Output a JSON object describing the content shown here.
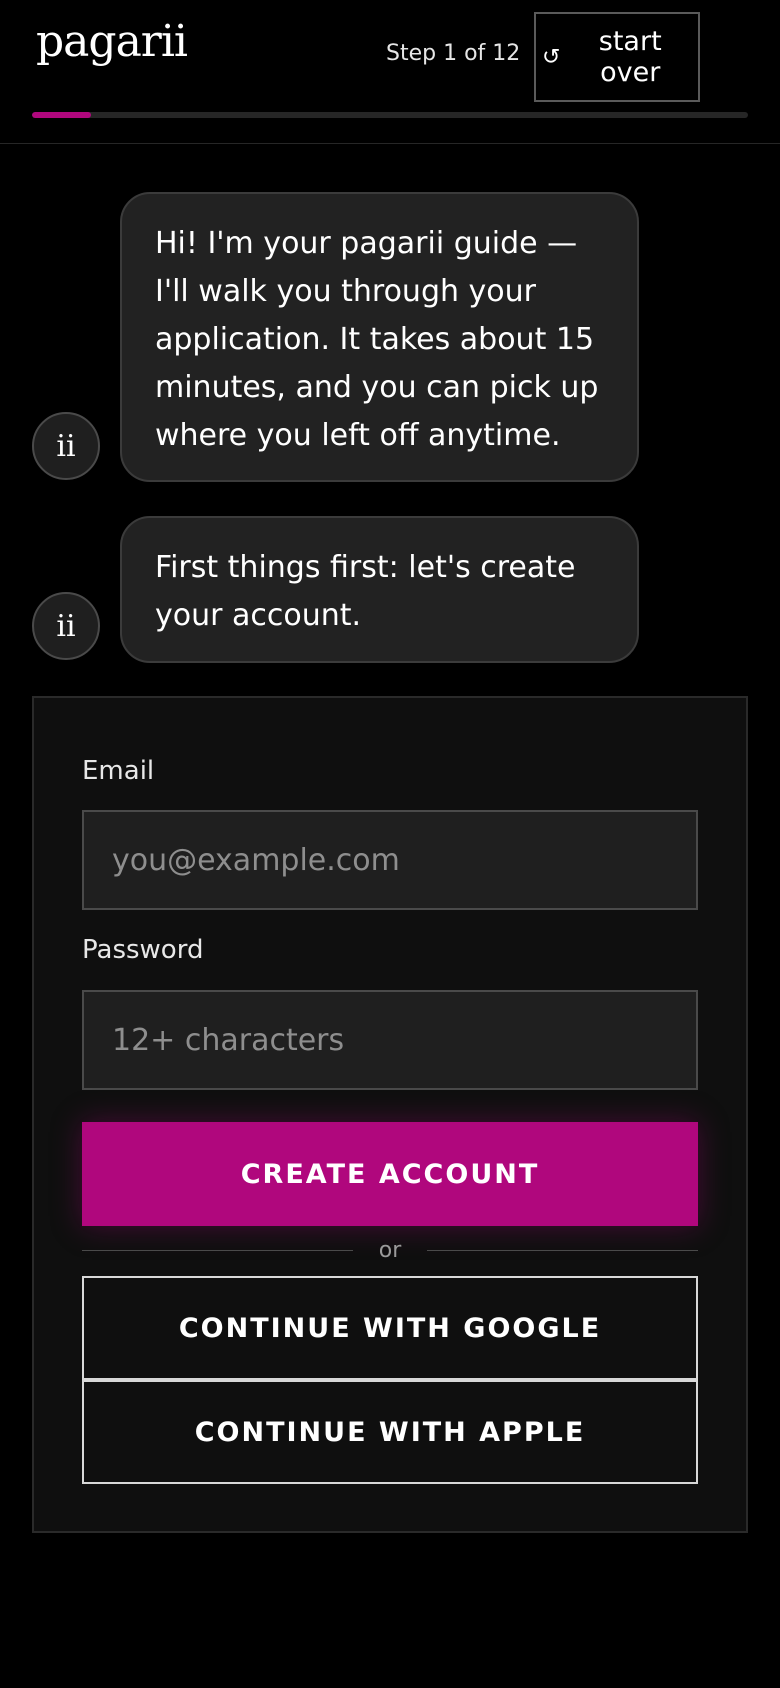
{
  "header": {
    "logo": "pagarii",
    "step_text": "Step 1 of 12",
    "start_over_icon": "restart-icon",
    "start_over_label": "start over",
    "progress": 0.083
  },
  "chat": {
    "avatar_text": "ii",
    "messages": [
      "Hi! I'm your pagarii guide — I'll walk you through your application. It takes about 15 minutes, and you can pick up where you left off anytime.",
      "First things first: let's create your account."
    ]
  },
  "form": {
    "email_label": "Email",
    "email_placeholder": "you@example.com",
    "email_value": "",
    "password_label": "Password",
    "password_placeholder": "12+ characters",
    "password_value": "",
    "create_button": "CREATE ACCOUNT",
    "divider_text": "or",
    "google_button": "CONTINUE WITH GOOGLE",
    "apple_button": "CONTINUE WITH APPLE"
  },
  "colors": {
    "accent": "#b0077d",
    "background": "#000000",
    "surface": "#0f0f0f",
    "bubble": "#222222"
  }
}
